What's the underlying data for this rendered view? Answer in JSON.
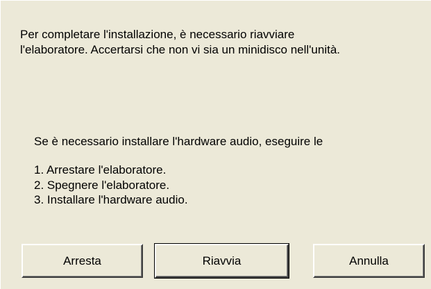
{
  "dialog": {
    "intro_line1": "Per completare l'installazione, è necessario riavviare",
    "intro_line2": "l'elaboratore. Accertarsi che non vi sia un minidisco nell'unità.",
    "note": "Se è necessario installare l'hardware audio, eseguire le",
    "steps": [
      "1. Arrestare l'elaboratore.",
      "2. Spegnere l'elaboratore.",
      "3. Installare l'hardware audio."
    ]
  },
  "buttons": {
    "shutdown_label": "Arresta",
    "restart_label": "Riavvia",
    "cancel_label": "Annulla"
  },
  "colors": {
    "dialog_background": "#ece9d8",
    "text": "#000000"
  }
}
